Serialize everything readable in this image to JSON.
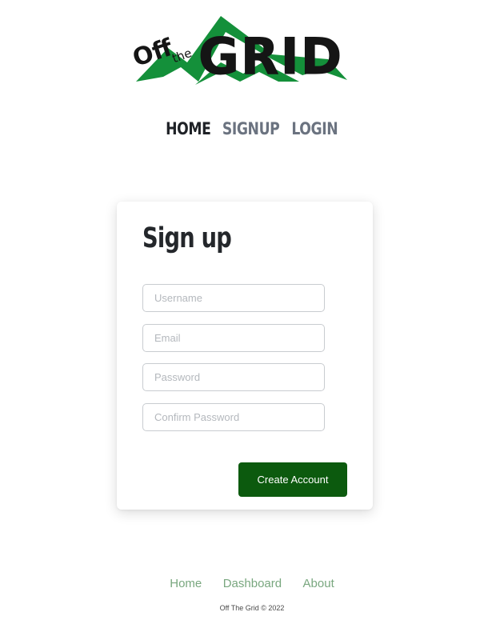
{
  "brand": {
    "logo_word_off": "Off",
    "logo_word_the": "the",
    "logo_word_grid": "GRID",
    "logo_green": "#14903a",
    "logo_ink": "#151515"
  },
  "nav": {
    "items": [
      {
        "label": "HOME",
        "active": true
      },
      {
        "label": "SIGNUP",
        "active": false
      },
      {
        "label": "LOGIN",
        "active": false
      }
    ]
  },
  "signup": {
    "title": "Sign up",
    "fields": [
      {
        "placeholder": "Username",
        "value": ""
      },
      {
        "placeholder": "Email",
        "value": ""
      },
      {
        "placeholder": "Password",
        "value": ""
      },
      {
        "placeholder": "Confirm Password",
        "value": ""
      }
    ],
    "submit_label": "Create Account",
    "submit_color": "#0c5a0e"
  },
  "footer": {
    "links": [
      {
        "label": "Home"
      },
      {
        "label": "Dashboard"
      },
      {
        "label": "About"
      }
    ],
    "copyright": "Off The Grid © 2022",
    "link_color": "#79a77f"
  }
}
